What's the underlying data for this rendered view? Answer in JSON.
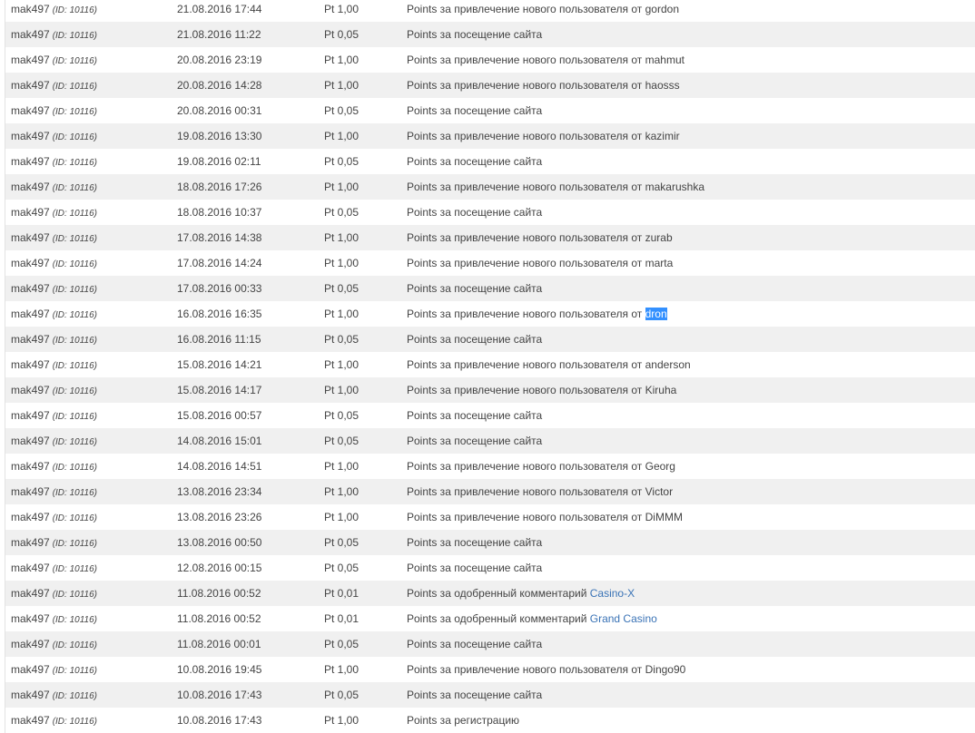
{
  "rows": [
    {
      "user": "mak497",
      "id": "(ID: 10116)",
      "date": "21.08.2016 17:44",
      "points": "Pt 1,00",
      "desc": "Points за привлечение нового пользователя от",
      "tail": "gordon"
    },
    {
      "user": "mak497",
      "id": "(ID: 10116)",
      "date": "21.08.2016 11:22",
      "points": "Pt 0,05",
      "desc": "Points за посещение сайта"
    },
    {
      "user": "mak497",
      "id": "(ID: 10116)",
      "date": "20.08.2016 23:19",
      "points": "Pt 1,00",
      "desc": "Points за привлечение нового пользователя от",
      "tail": "mahmut"
    },
    {
      "user": "mak497",
      "id": "(ID: 10116)",
      "date": "20.08.2016 14:28",
      "points": "Pt 1,00",
      "desc": "Points за привлечение нового пользователя от",
      "tail": "haosss"
    },
    {
      "user": "mak497",
      "id": "(ID: 10116)",
      "date": "20.08.2016 00:31",
      "points": "Pt 0,05",
      "desc": "Points за посещение сайта"
    },
    {
      "user": "mak497",
      "id": "(ID: 10116)",
      "date": "19.08.2016 13:30",
      "points": "Pt 1,00",
      "desc": "Points за привлечение нового пользователя от",
      "tail": "kazimir"
    },
    {
      "user": "mak497",
      "id": "(ID: 10116)",
      "date": "19.08.2016 02:11",
      "points": "Pt 0,05",
      "desc": "Points за посещение сайта"
    },
    {
      "user": "mak497",
      "id": "(ID: 10116)",
      "date": "18.08.2016 17:26",
      "points": "Pt 1,00",
      "desc": "Points за привлечение нового пользователя от",
      "tail": "makarushka"
    },
    {
      "user": "mak497",
      "id": "(ID: 10116)",
      "date": "18.08.2016 10:37",
      "points": "Pt 0,05",
      "desc": "Points за посещение сайта"
    },
    {
      "user": "mak497",
      "id": "(ID: 10116)",
      "date": "17.08.2016 14:38",
      "points": "Pt 1,00",
      "desc": "Points за привлечение нового пользователя от",
      "tail": "zurab"
    },
    {
      "user": "mak497",
      "id": "(ID: 10116)",
      "date": "17.08.2016 14:24",
      "points": "Pt 1,00",
      "desc": "Points за привлечение нового пользователя от",
      "tail": "marta"
    },
    {
      "user": "mak497",
      "id": "(ID: 10116)",
      "date": "17.08.2016 00:33",
      "points": "Pt 0,05",
      "desc": "Points за посещение сайта"
    },
    {
      "user": "mak497",
      "id": "(ID: 10116)",
      "date": "16.08.2016 16:35",
      "points": "Pt 1,00",
      "desc": "Points за привлечение нового пользователя от",
      "tail": "dron",
      "selected": true
    },
    {
      "user": "mak497",
      "id": "(ID: 10116)",
      "date": "16.08.2016 11:15",
      "points": "Pt 0,05",
      "desc": "Points за посещение сайта"
    },
    {
      "user": "mak497",
      "id": "(ID: 10116)",
      "date": "15.08.2016 14:21",
      "points": "Pt 1,00",
      "desc": "Points за привлечение нового пользователя от",
      "tail": "anderson"
    },
    {
      "user": "mak497",
      "id": "(ID: 10116)",
      "date": "15.08.2016 14:17",
      "points": "Pt 1,00",
      "desc": "Points за привлечение нового пользователя от",
      "tail": "Kiruha"
    },
    {
      "user": "mak497",
      "id": "(ID: 10116)",
      "date": "15.08.2016 00:57",
      "points": "Pt 0,05",
      "desc": "Points за посещение сайта"
    },
    {
      "user": "mak497",
      "id": "(ID: 10116)",
      "date": "14.08.2016 15:01",
      "points": "Pt 0,05",
      "desc": "Points за посещение сайта"
    },
    {
      "user": "mak497",
      "id": "(ID: 10116)",
      "date": "14.08.2016 14:51",
      "points": "Pt 1,00",
      "desc": "Points за привлечение нового пользователя от",
      "tail": "Georg"
    },
    {
      "user": "mak497",
      "id": "(ID: 10116)",
      "date": "13.08.2016 23:34",
      "points": "Pt 1,00",
      "desc": "Points за привлечение нового пользователя от",
      "tail": "Victor"
    },
    {
      "user": "mak497",
      "id": "(ID: 10116)",
      "date": "13.08.2016 23:26",
      "points": "Pt 1,00",
      "desc": "Points за привлечение нового пользователя от",
      "tail": "DiMMM"
    },
    {
      "user": "mak497",
      "id": "(ID: 10116)",
      "date": "13.08.2016 00:50",
      "points": "Pt 0,05",
      "desc": "Points за посещение сайта"
    },
    {
      "user": "mak497",
      "id": "(ID: 10116)",
      "date": "12.08.2016 00:15",
      "points": "Pt 0,05",
      "desc": "Points за посещение сайта"
    },
    {
      "user": "mak497",
      "id": "(ID: 10116)",
      "date": "11.08.2016 00:52",
      "points": "Pt 0,01",
      "desc": "Points за одобренный комментарий",
      "link": "Casino-X"
    },
    {
      "user": "mak497",
      "id": "(ID: 10116)",
      "date": "11.08.2016 00:52",
      "points": "Pt 0,01",
      "desc": "Points за одобренный комментарий",
      "link": "Grand Casino"
    },
    {
      "user": "mak497",
      "id": "(ID: 10116)",
      "date": "11.08.2016 00:01",
      "points": "Pt 0,05",
      "desc": "Points за посещение сайта"
    },
    {
      "user": "mak497",
      "id": "(ID: 10116)",
      "date": "10.08.2016 19:45",
      "points": "Pt 1,00",
      "desc": "Points за привлечение нового пользователя от",
      "tail": "Dingo90"
    },
    {
      "user": "mak497",
      "id": "(ID: 10116)",
      "date": "10.08.2016 17:43",
      "points": "Pt 0,05",
      "desc": "Points за посещение сайта"
    },
    {
      "user": "mak497",
      "id": "(ID: 10116)",
      "date": "10.08.2016 17:43",
      "points": "Pt 1,00",
      "desc": "Points за регистрацию"
    }
  ],
  "colors": {
    "row_alt": "#f0f0f0",
    "link": "#3a73b6",
    "selection": "#3390ff"
  }
}
